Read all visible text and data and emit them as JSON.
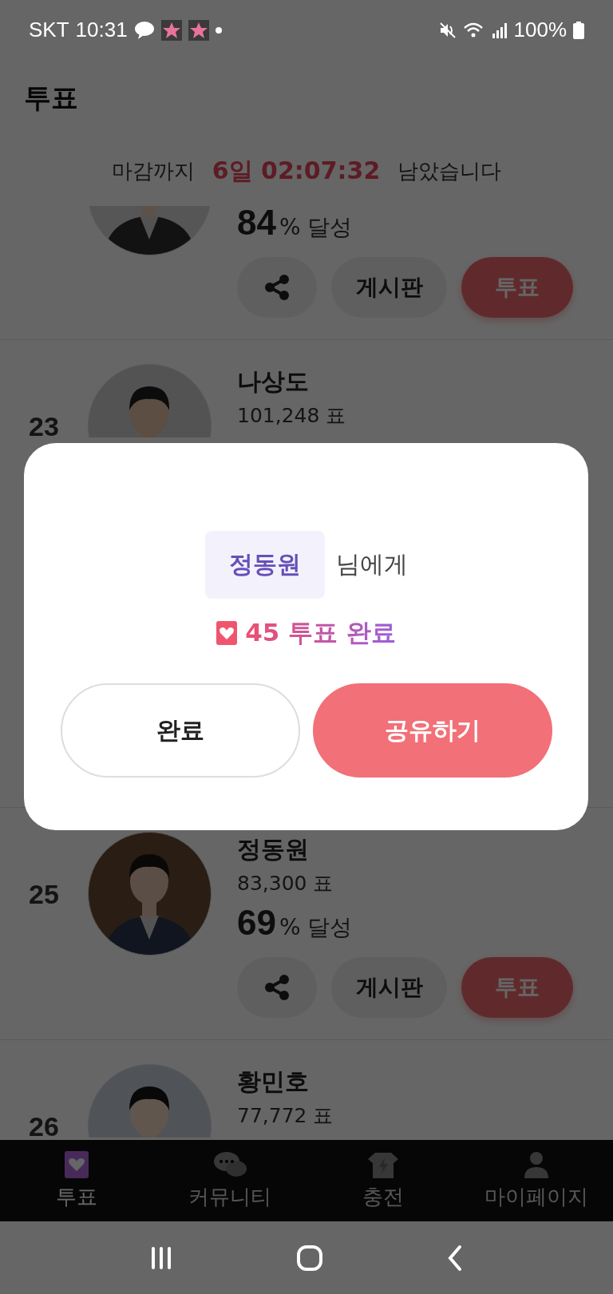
{
  "status_bar": {
    "carrier": "SKT",
    "time": "10:31",
    "battery": "100%"
  },
  "header": {
    "title": "투표"
  },
  "countdown": {
    "prefix": "마감까지",
    "remaining": "6일 02:07:32",
    "suffix": "남았습니다"
  },
  "candidates": [
    {
      "percent": "84",
      "percent_unit": "% 달성",
      "board_button": "게시판",
      "vote_button": "투표"
    },
    {
      "rank": "23",
      "name": "나상도",
      "votes": "101,248 표"
    },
    {
      "rank": "25",
      "name": "정동원",
      "votes": "83,300 표",
      "percent": "69",
      "percent_unit": "% 달성",
      "board_button": "게시판",
      "vote_button": "투표"
    },
    {
      "rank": "26",
      "name": "황민호",
      "votes": "77,772 표"
    }
  ],
  "dialog": {
    "recipient": "정동원",
    "recipient_suffix": "님에게",
    "result": "45 투표 완료",
    "buttons": [
      {
        "label": "완료",
        "kind": "secondary"
      },
      {
        "label": "공유하기",
        "kind": "primary"
      }
    ]
  },
  "bottom_nav": [
    {
      "label": "투표",
      "selected": true
    },
    {
      "label": "커뮤니티",
      "selected": false
    },
    {
      "label": "충전",
      "selected": false
    },
    {
      "label": "마이페이지",
      "selected": false
    }
  ]
}
